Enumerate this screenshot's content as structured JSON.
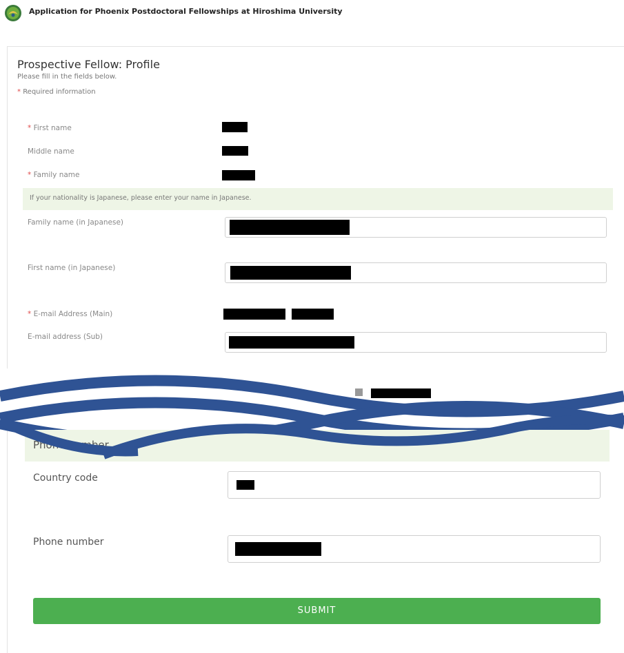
{
  "header": {
    "title": "Application for Phoenix Postdoctoral Fellowships at Hiroshima University",
    "logo_icon": "university-emblem-icon"
  },
  "form": {
    "title": "Prospective Fellow: Profile",
    "instructions": "Please fill in the fields below.",
    "required_marker": "*",
    "required_note": "Required information",
    "fields": {
      "first_name": {
        "label": "First name",
        "required": true
      },
      "middle_name": {
        "label": "Middle name",
        "required": false
      },
      "family_name": {
        "label": "Family name",
        "required": true
      },
      "japanese_notice": "If your nationality is Japanese, please enter your name in Japanese.",
      "family_name_jp": {
        "label": "Family name (in Japanese)",
        "required": false
      },
      "first_name_jp": {
        "label": "First name (in Japanese)",
        "required": false
      },
      "email_main": {
        "label": "E-mail Address (Main)",
        "required": true
      },
      "email_sub": {
        "label": "E-mail address (Sub)",
        "required": false
      }
    },
    "phone_section": {
      "notice": "Phone number",
      "country_code": {
        "label": "Country code"
      },
      "phone_number": {
        "label": "Phone number"
      }
    },
    "submit_label": "SUBMIT"
  },
  "colors": {
    "accent_green": "#4caf50",
    "notice_bg": "#eef5e6",
    "required_red": "#e04b4b",
    "wave_blue": "#2f5394"
  }
}
